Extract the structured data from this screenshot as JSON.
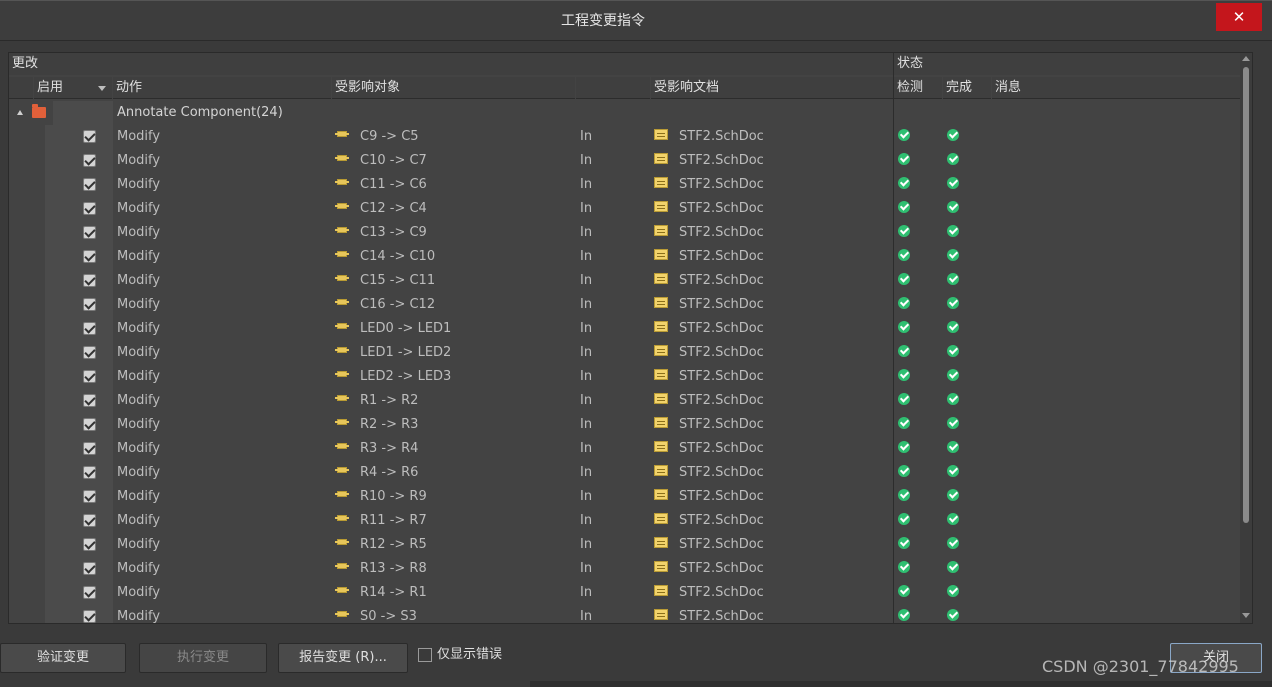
{
  "window": {
    "title": "工程变更指令",
    "close_icon": "close-icon"
  },
  "groups": {
    "changes": "更改",
    "status": "状态"
  },
  "columns": {
    "enable": "启用",
    "action": "动作",
    "affected_object": "受影响对象",
    "in_col": "",
    "affected_doc": "受影响文档",
    "check": "检测",
    "done": "完成",
    "message": "消息"
  },
  "group_row": {
    "label": "Annotate Component(24)"
  },
  "rows": [
    {
      "action": "Modify",
      "object": "C9 -> C5",
      "in": "In",
      "doc": "STF2.SchDoc"
    },
    {
      "action": "Modify",
      "object": "C10 -> C7",
      "in": "In",
      "doc": "STF2.SchDoc"
    },
    {
      "action": "Modify",
      "object": "C11 -> C6",
      "in": "In",
      "doc": "STF2.SchDoc"
    },
    {
      "action": "Modify",
      "object": "C12 -> C4",
      "in": "In",
      "doc": "STF2.SchDoc"
    },
    {
      "action": "Modify",
      "object": "C13 -> C9",
      "in": "In",
      "doc": "STF2.SchDoc"
    },
    {
      "action": "Modify",
      "object": "C14 -> C10",
      "in": "In",
      "doc": "STF2.SchDoc"
    },
    {
      "action": "Modify",
      "object": "C15 -> C11",
      "in": "In",
      "doc": "STF2.SchDoc"
    },
    {
      "action": "Modify",
      "object": "C16 -> C12",
      "in": "In",
      "doc": "STF2.SchDoc"
    },
    {
      "action": "Modify",
      "object": "LED0 -> LED1",
      "in": "In",
      "doc": "STF2.SchDoc"
    },
    {
      "action": "Modify",
      "object": "LED1 -> LED2",
      "in": "In",
      "doc": "STF2.SchDoc"
    },
    {
      "action": "Modify",
      "object": "LED2 -> LED3",
      "in": "In",
      "doc": "STF2.SchDoc"
    },
    {
      "action": "Modify",
      "object": "R1 -> R2",
      "in": "In",
      "doc": "STF2.SchDoc"
    },
    {
      "action": "Modify",
      "object": "R2 -> R3",
      "in": "In",
      "doc": "STF2.SchDoc"
    },
    {
      "action": "Modify",
      "object": "R3 -> R4",
      "in": "In",
      "doc": "STF2.SchDoc"
    },
    {
      "action": "Modify",
      "object": "R4 -> R6",
      "in": "In",
      "doc": "STF2.SchDoc"
    },
    {
      "action": "Modify",
      "object": "R10 -> R9",
      "in": "In",
      "doc": "STF2.SchDoc"
    },
    {
      "action": "Modify",
      "object": "R11 -> R7",
      "in": "In",
      "doc": "STF2.SchDoc"
    },
    {
      "action": "Modify",
      "object": "R12 -> R5",
      "in": "In",
      "doc": "STF2.SchDoc"
    },
    {
      "action": "Modify",
      "object": "R13 -> R8",
      "in": "In",
      "doc": "STF2.SchDoc"
    },
    {
      "action": "Modify",
      "object": "R14 -> R1",
      "in": "In",
      "doc": "STF2.SchDoc"
    },
    {
      "action": "Modify",
      "object": "S0 -> S3",
      "in": "In",
      "doc": "STF2.SchDoc"
    }
  ],
  "footer": {
    "validate": "验证变更",
    "execute": "执行变更",
    "report": "报告变更 (R)...",
    "only_errors": "仅显示错误",
    "close": "关闭"
  },
  "watermark": "CSDN @2301_77842995",
  "colors": {
    "ok": "#2fbf71",
    "close_bg": "#c4161c",
    "panel": "#434343"
  }
}
